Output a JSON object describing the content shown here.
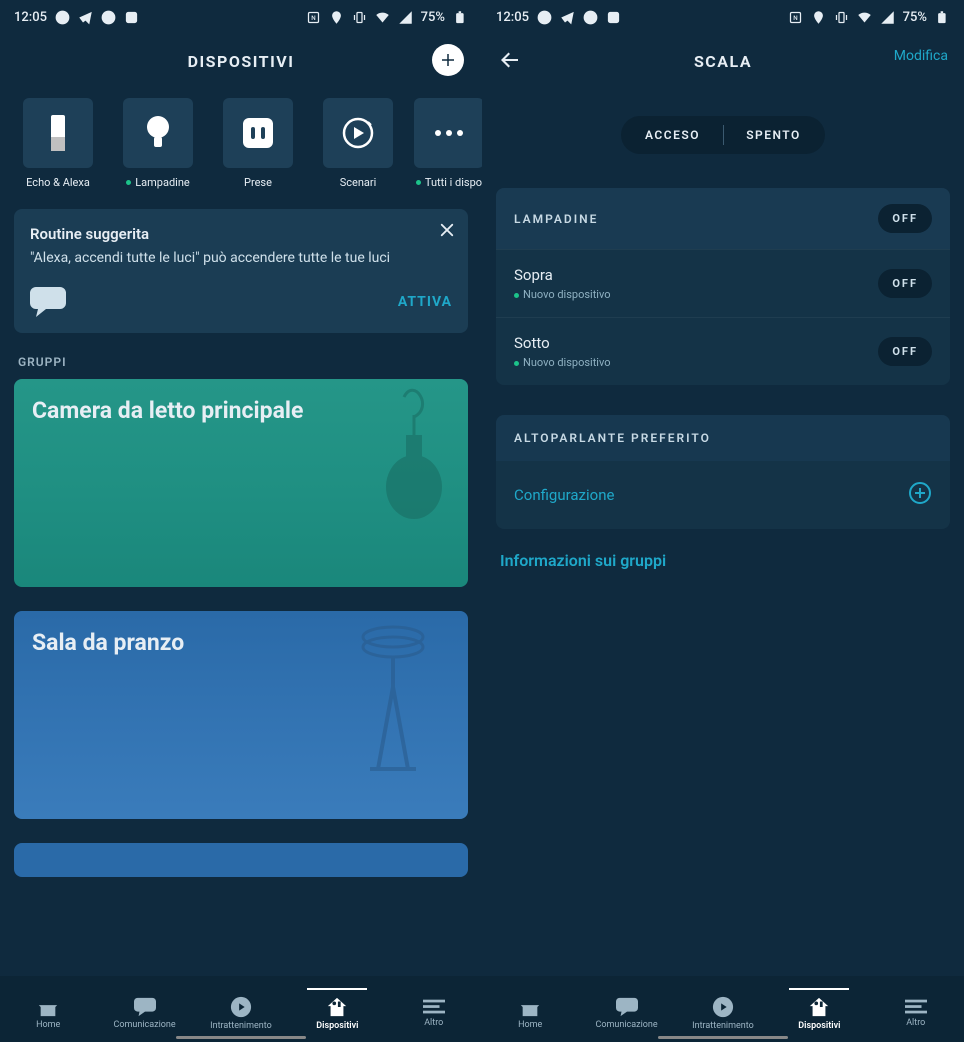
{
  "statusbar": {
    "time": "12:05",
    "battery": "75%"
  },
  "left": {
    "title": "DISPOSITIVI",
    "categories": [
      {
        "label": "Echo & Alexa",
        "online": false
      },
      {
        "label": "Lampadine",
        "online": true
      },
      {
        "label": "Prese",
        "online": false
      },
      {
        "label": "Scenari",
        "online": false
      },
      {
        "label": "Tutti i dispo",
        "online": true
      }
    ],
    "routine": {
      "title": "Routine suggerita",
      "body": "\"Alexa, accendi tutte le luci\" può accendere tutte le tue luci",
      "action": "ATTIVA"
    },
    "groups_label": "GRUPPI",
    "groups": [
      {
        "name": "Camera da letto principale"
      },
      {
        "name": "Sala da pranzo"
      }
    ]
  },
  "right": {
    "title": "SCALA",
    "edit": "Modifica",
    "segmented": {
      "on": "ACCESO",
      "off": "SPENTO"
    },
    "lamp_section": "LAMPADINE",
    "section_toggle": "OFF",
    "devices": [
      {
        "name": "Sopra",
        "sub": "Nuovo dispositivo",
        "state": "OFF"
      },
      {
        "name": "Sotto",
        "sub": "Nuovo dispositivo",
        "state": "OFF"
      }
    ],
    "speaker_section": "ALTOPARLANTE PREFERITO",
    "config": "Configurazione",
    "info": "Informazioni sui gruppi"
  },
  "bottomnav": [
    {
      "label": "Home"
    },
    {
      "label": "Comunicazione"
    },
    {
      "label": "Intrattenimento"
    },
    {
      "label": "Dispositivi"
    },
    {
      "label": "Altro"
    }
  ]
}
